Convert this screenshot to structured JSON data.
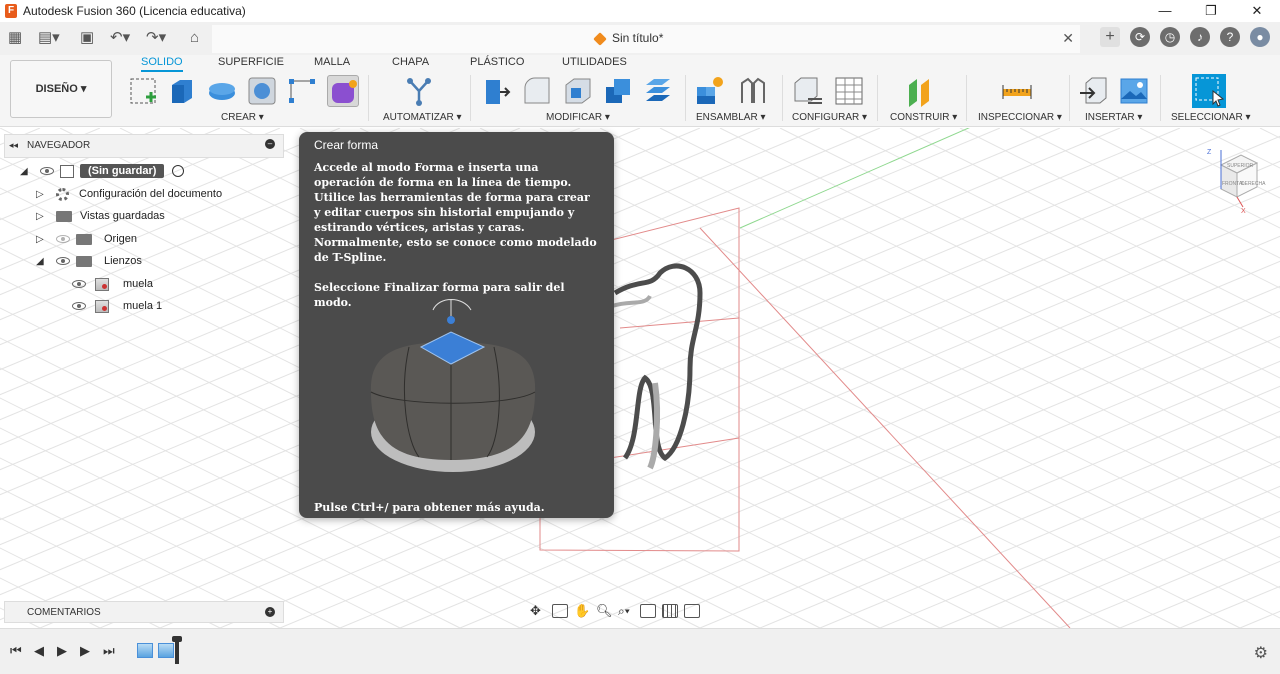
{
  "app": {
    "title": "Autodesk Fusion 360 (Licencia educativa)",
    "icon_letter": "F",
    "window_controls": [
      "—",
      "❐",
      "✕"
    ]
  },
  "document": {
    "tab_title": "Sin título*",
    "close": "✕"
  },
  "toolbar": {
    "workspace_label": "DISEÑO ▾",
    "tabs": [
      "SOLIDO",
      "SUPERFICIE",
      "MALLA",
      "CHAPA",
      "PLÁSTICO",
      "UTILIDADES"
    ],
    "active_tab": "SOLIDO",
    "groups": [
      "CREAR ▾",
      "AUTOMATIZAR ▾",
      "MODIFICAR ▾",
      "ENSAMBLAR ▾",
      "CONFIGURAR ▾",
      "CONSTRUIR ▾",
      "INSPECCIONAR ▾",
      "INSERTAR ▾",
      "SELECCIONAR ▾"
    ]
  },
  "navigator": {
    "title": "NAVEGADOR",
    "root": "(Sin guardar)",
    "items": [
      {
        "label": "Configuración del documento"
      },
      {
        "label": "Vistas guardadas"
      },
      {
        "label": "Origen"
      },
      {
        "label": "Lienzos"
      },
      {
        "label": "muela"
      },
      {
        "label": "muela 1"
      }
    ]
  },
  "comments": {
    "title": "COMENTARIOS"
  },
  "tooltip": {
    "title": "Crear forma",
    "paragraph1": "Accede al modo Forma e inserta una operación de forma en la línea de tiempo. Utilice las herramientas de forma para crear y editar cuerpos sin historial empujando y estirando vértices, aristas y caras. Normalmente, esto se conoce como modelado de T-Spline.",
    "paragraph2": "Seleccione Finalizar forma para salir del modo.",
    "footer": "Pulse Ctrl+/ para obtener más ayuda."
  },
  "viewcube": {
    "labels": [
      "SUPERIOR",
      "FRONTAL",
      "DERECHA"
    ],
    "axes": [
      "Z",
      "X"
    ]
  },
  "colors": {
    "accent": "#0696d7",
    "tooltip_bg": "#4b4b4b",
    "app_orange": "#e85c1b",
    "grid": "#d9d9d9"
  }
}
